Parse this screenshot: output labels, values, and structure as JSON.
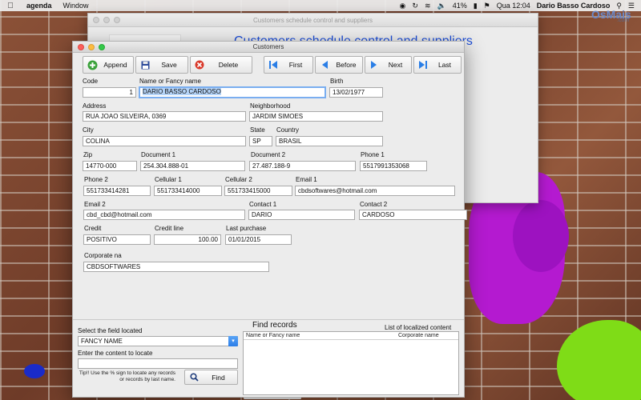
{
  "menubar": {
    "app_name": "agenda",
    "menu_window": "Window",
    "battery": "41%",
    "time": "Qua 12:04",
    "user": "Dario Basso Cardoso"
  },
  "logo": {
    "main": "OsMais",
    "sub": ".com"
  },
  "back_window": {
    "title": "Customers schedule control and suppliers",
    "headline": "Customers schedule control and suppliers"
  },
  "window": {
    "title": "Customers",
    "toolbar": {
      "append": "Append",
      "save": "Save",
      "delete": "Delete",
      "first": "First",
      "before": "Before",
      "next": "Next",
      "last": "Last"
    },
    "labels": {
      "code": "Code",
      "name": "Name or Fancy name",
      "birth": "Birth",
      "address": "Address",
      "neighborhood": "Neighborhood",
      "city": "City",
      "state": "State",
      "country": "Country",
      "zip": "Zip",
      "document1": "Document 1",
      "document2": "Document 2",
      "phone1": "Phone 1",
      "phone2": "Phone 2",
      "cellular1": "Cellular 1",
      "cellular2": "Cellular 2",
      "email1": "Email 1",
      "email2": "Email 2",
      "contact1": "Contact 1",
      "contact2": "Contact 2",
      "credit": "Credit",
      "credit_line": "Credit line",
      "last_purchase": "Last purchase",
      "corporate": "Corporate na"
    },
    "values": {
      "code": "1",
      "name": "DARIO BASSO CARDOSO",
      "birth": "13/02/1977",
      "address": "RUA JOAO SILVEIRA, 0369",
      "neighborhood": "JARDIM SIMOES",
      "city": "COLINA",
      "state": "SP",
      "country": "BRASIL",
      "zip": "14770-000",
      "document1": "254.304.888-01",
      "document2": "27.487.188-9",
      "phone1": "5517991353068",
      "phone2": "551733414281",
      "cellular1": "551733414000",
      "cellular2": "551733415000",
      "email1": "cbdsoftwares@hotmail.com",
      "email2": "cbd_cbd@hotmail.com",
      "contact1": "DARIO",
      "contact2": "CARDOSO",
      "credit": "POSITIVO",
      "credit_line": "100.00",
      "last_purchase": "01/01/2015",
      "corporate": "CBDSOFTWARES"
    },
    "find": {
      "select_label": "Select the field located",
      "select_value": "FANCY NAME",
      "content_label": "Enter the content to locate",
      "content_value": "",
      "tip": "Tip!! Use the % sign to locate any records or records by last name.",
      "find_button": "Find",
      "title": "Find records",
      "list_title": "List of localized content",
      "col_name": "Name or Fancy name",
      "col_corporate": "Corporate name"
    }
  }
}
